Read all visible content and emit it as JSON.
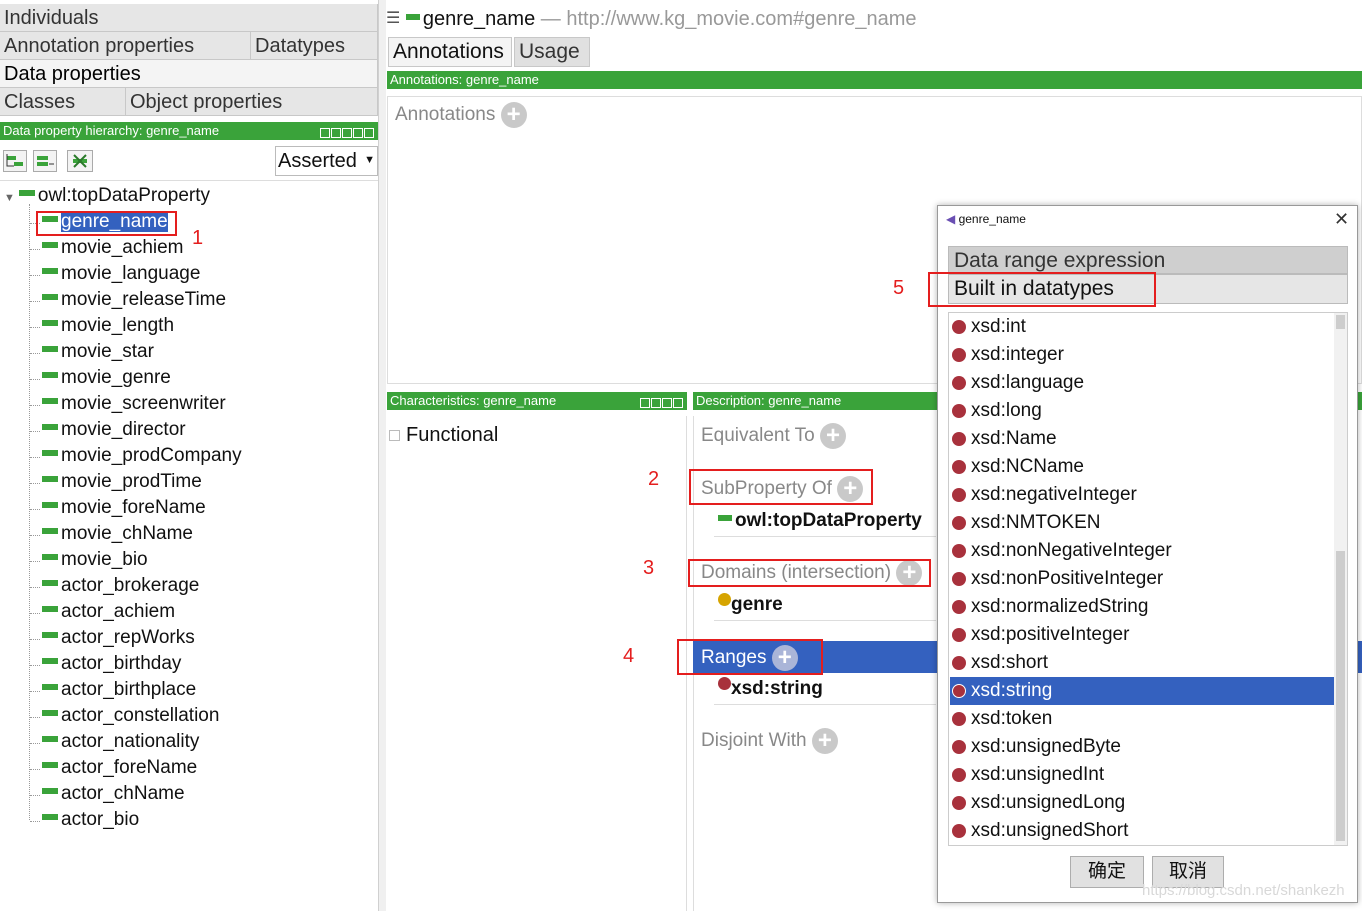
{
  "left_tabs": {
    "individuals": "Individuals",
    "annotation_properties": "Annotation properties",
    "datatypes": "Datatypes",
    "data_properties": "Data properties",
    "classes": "Classes",
    "object_properties": "Object properties"
  },
  "hierarchy": {
    "header": "Data property hierarchy: genre_name",
    "asserted": "Asserted",
    "root": "owl:topDataProperty",
    "items": [
      "genre_name",
      "movie_achiem",
      "movie_language",
      "movie_releaseTime",
      "movie_length",
      "movie_star",
      "movie_genre",
      "movie_screenwriter",
      "movie_director",
      "movie_prodCompany",
      "movie_prodTime",
      "movie_foreName",
      "movie_chName",
      "movie_bio",
      "actor_brokerage",
      "actor_achiem",
      "actor_repWorks",
      "actor_birthday",
      "actor_birthplace",
      "actor_constellation",
      "actor_nationality",
      "actor_foreName",
      "actor_chName",
      "actor_bio"
    ]
  },
  "entity": {
    "name": "genre_name",
    "iri": "— http://www.kg_movie.com#genre_name"
  },
  "main_tabs": {
    "annotations": "Annotations",
    "usage": "Usage"
  },
  "annotations_panel": {
    "header": "Annotations: genre_name",
    "label": "Annotations"
  },
  "characteristics": {
    "header": "Characteristics: genre_name",
    "functional": "Functional"
  },
  "description": {
    "header": "Description: genre_name",
    "equivalent_to": "Equivalent To",
    "subproperty_of": "SubProperty Of",
    "subproperty_value": "owl:topDataProperty",
    "domains": "Domains (intersection)",
    "domain_value": "genre",
    "ranges": "Ranges",
    "range_value": "xsd:string",
    "disjoint_with": "Disjoint With"
  },
  "annotations_numbers": [
    "1",
    "2",
    "3",
    "4",
    "5"
  ],
  "dialog": {
    "title": "genre_name",
    "tab_data_range": "Data range expression",
    "tab_builtin": "Built in datatypes",
    "datatypes": [
      "xsd:int",
      "xsd:integer",
      "xsd:language",
      "xsd:long",
      "xsd:Name",
      "xsd:NCName",
      "xsd:negativeInteger",
      "xsd:NMTOKEN",
      "xsd:nonNegativeInteger",
      "xsd:nonPositiveInteger",
      "xsd:normalizedString",
      "xsd:positiveInteger",
      "xsd:short",
      "xsd:string",
      "xsd:token",
      "xsd:unsignedByte",
      "xsd:unsignedInt",
      "xsd:unsignedLong",
      "xsd:unsignedShort"
    ],
    "selected": "xsd:string",
    "ok": "确定",
    "cancel": "取消"
  },
  "watermark": "https://blog.csdn.net/shankezh",
  "colors": {
    "green": "#3aa33a",
    "selection": "#3461bf",
    "annotation_red": "#e41e1e",
    "datatype_dot": "#a8313c"
  }
}
